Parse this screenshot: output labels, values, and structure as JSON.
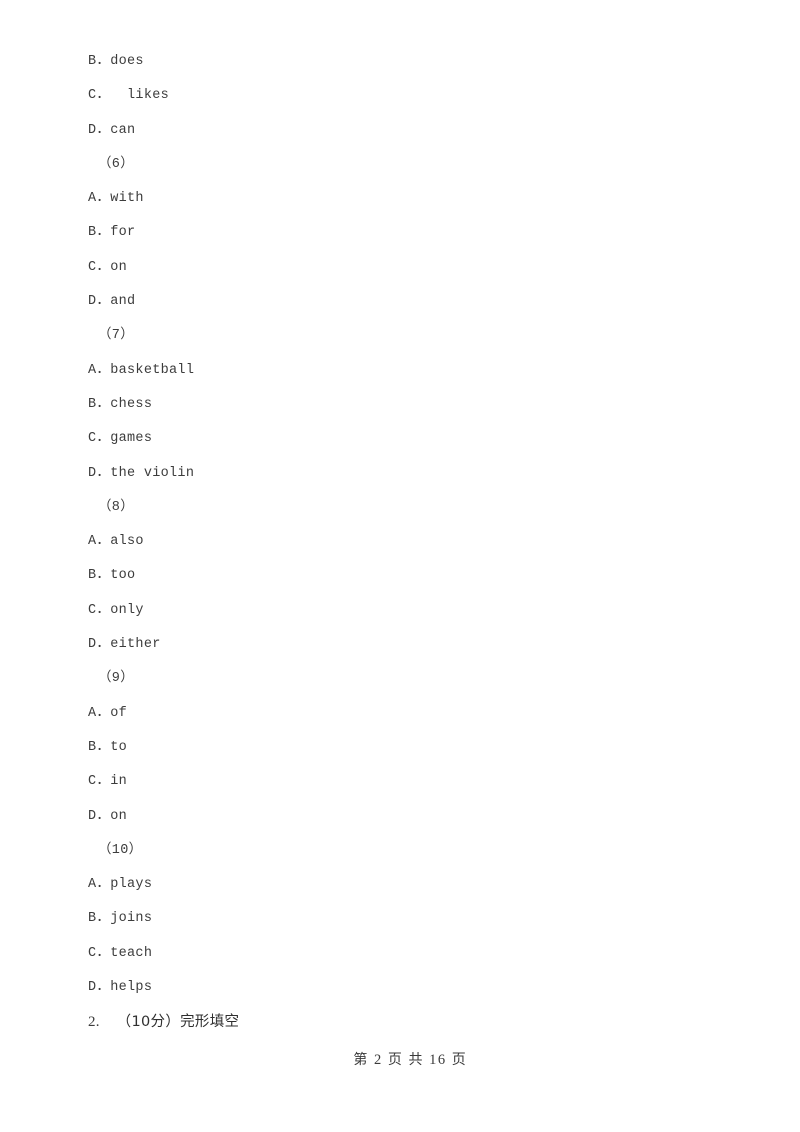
{
  "document": {
    "page_background": "#ffffff",
    "text_color": "#3c3c3c",
    "subject_hint": "English exam — multiple choice options"
  },
  "body_lines": [
    {
      "kind": "option",
      "letter": "B",
      "separator": "．",
      "text": "does"
    },
    {
      "kind": "option",
      "letter": "C",
      "separator": "． ",
      "text": " likes"
    },
    {
      "kind": "option",
      "letter": "D",
      "separator": "．",
      "text": "can"
    },
    {
      "kind": "group",
      "label": "（6）"
    },
    {
      "kind": "option",
      "letter": "A",
      "separator": "．",
      "text": "with"
    },
    {
      "kind": "option",
      "letter": "B",
      "separator": "．",
      "text": "for"
    },
    {
      "kind": "option",
      "letter": "C",
      "separator": "．",
      "text": "on"
    },
    {
      "kind": "option",
      "letter": "D",
      "separator": "．",
      "text": "and"
    },
    {
      "kind": "group",
      "label": "（7）"
    },
    {
      "kind": "option",
      "letter": "A",
      "separator": "．",
      "text": "basketball"
    },
    {
      "kind": "option",
      "letter": "B",
      "separator": "．",
      "text": "chess"
    },
    {
      "kind": "option",
      "letter": "C",
      "separator": "．",
      "text": "games"
    },
    {
      "kind": "option",
      "letter": "D",
      "separator": "．",
      "text": "the violin"
    },
    {
      "kind": "group",
      "label": "（8）"
    },
    {
      "kind": "option",
      "letter": "A",
      "separator": "．",
      "text": "also"
    },
    {
      "kind": "option",
      "letter": "B",
      "separator": "．",
      "text": "too"
    },
    {
      "kind": "option",
      "letter": "C",
      "separator": "．",
      "text": "only"
    },
    {
      "kind": "option",
      "letter": "D",
      "separator": "．",
      "text": "either"
    },
    {
      "kind": "group",
      "label": "（9）"
    },
    {
      "kind": "option",
      "letter": "A",
      "separator": "．",
      "text": "of"
    },
    {
      "kind": "option",
      "letter": "B",
      "separator": "．",
      "text": "to"
    },
    {
      "kind": "option",
      "letter": "C",
      "separator": "．",
      "text": "in"
    },
    {
      "kind": "option",
      "letter": "D",
      "separator": "．",
      "text": "on"
    },
    {
      "kind": "group",
      "label": "（10）"
    },
    {
      "kind": "option",
      "letter": "A",
      "separator": "．",
      "text": "plays"
    },
    {
      "kind": "option",
      "letter": "B",
      "separator": "．",
      "text": "joins"
    },
    {
      "kind": "option",
      "letter": "C",
      "separator": "．",
      "text": "teach"
    },
    {
      "kind": "option",
      "letter": "D",
      "separator": "．",
      "text": "helps"
    },
    {
      "kind": "question",
      "number": "2.",
      "score": "（10分）",
      "title": "完形填空"
    }
  ],
  "footer": {
    "prefix": "第",
    "current_page": "2",
    "page_unit": "页",
    "of_label": "共",
    "total_pages": "16",
    "total_unit": "页",
    "full_text": "第 2 页 共 16 页"
  }
}
